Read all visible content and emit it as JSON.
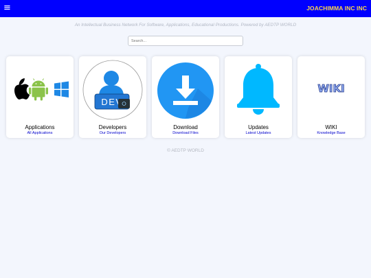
{
  "header": {
    "menu_icon": "≡",
    "brand": "JOACHIMMA INC INC",
    "bg_color": "#0000ff",
    "brand_color": "#ffd84a"
  },
  "tagline": "An Intellectual Business Network For Software, Applications, Educational Productions. Powered by AEDTP WORLD",
  "search": {
    "placeholder": "Search..."
  },
  "cards": [
    {
      "title": "Applications",
      "link": "All Applications",
      "icon": "apple-android-windows-icons"
    },
    {
      "title": "Developers",
      "link": "Our Developers",
      "icon": "developer-icon",
      "icon_text": "DEV"
    },
    {
      "title": "Download",
      "link": "Download Files",
      "icon": "download-icon"
    },
    {
      "title": "Updates",
      "link": "Latest Updates",
      "icon": "bell-icon"
    },
    {
      "title": "WIKI",
      "link": "Knowledge Base",
      "icon": "wiki-icon",
      "icon_text": "WIKI"
    }
  ],
  "footer": "© AEDTP WORLD"
}
